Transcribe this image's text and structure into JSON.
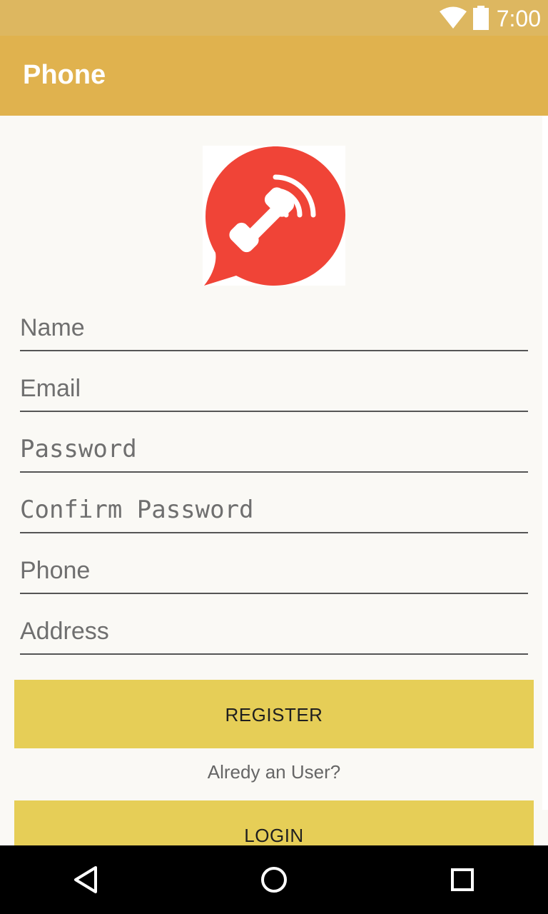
{
  "status_bar": {
    "time": "7:00",
    "icons": [
      "wifi-icon",
      "battery-icon"
    ]
  },
  "app_bar": {
    "title": "Phone"
  },
  "logo": {
    "icon": "phone-call-bubble-icon",
    "colors": {
      "bubble": "#f04437",
      "glyph": "#ffffff"
    }
  },
  "form": {
    "name_placeholder": "Name",
    "email_placeholder": "Email",
    "password_placeholder": "Password",
    "confirm_password_placeholder": "Confirm Password",
    "phone_placeholder": "Phone",
    "address_placeholder": "Address"
  },
  "actions": {
    "register_label": "REGISTER",
    "already_user_text": "Alredy an User?",
    "login_label": "LOGIN"
  },
  "nav_bar": {
    "icons": [
      "back-icon",
      "home-icon",
      "recents-icon"
    ]
  },
  "colors": {
    "status_bar": "#ddb760",
    "app_bar": "#e0b24e",
    "button": "#e6ce57",
    "background": "#faf9f5"
  }
}
